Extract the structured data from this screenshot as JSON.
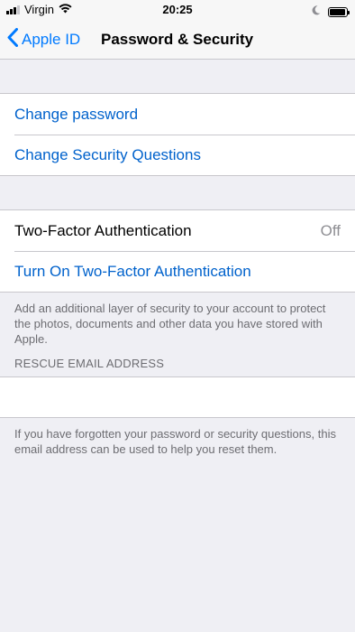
{
  "status_bar": {
    "carrier": "Virgin",
    "time": "20:25"
  },
  "nav": {
    "back_label": "Apple ID",
    "title": "Password & Security"
  },
  "account_group": {
    "change_password": "Change password",
    "change_security_questions": "Change Security Questions"
  },
  "two_factor_group": {
    "label": "Two-Factor Authentication",
    "value": "Off",
    "turn_on": "Turn On Two-Factor Authentication",
    "footer": "Add an additional layer of security to your account to protect the photos, documents and other data you have stored with Apple."
  },
  "rescue_email": {
    "header": "RESCUE EMAIL ADDRESS",
    "value": "",
    "footer": "If you have forgotten your password or security questions, this email address can be used to help you reset them."
  },
  "colors": {
    "tint": "#007aff",
    "background": "#efeff4",
    "separator": "#c8c7cc",
    "secondary_text": "#6d6d72"
  }
}
